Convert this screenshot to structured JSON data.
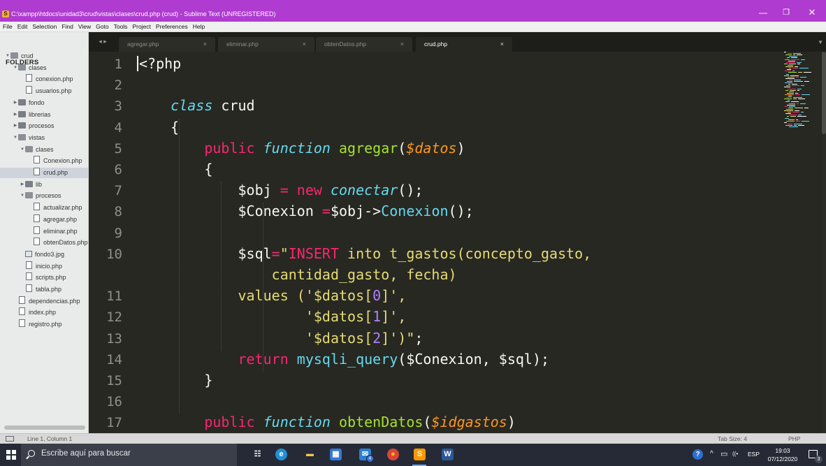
{
  "window": {
    "title": "C:\\xampp\\htdocs\\unidad3\\crud\\vistas\\clases\\crud.php (crud) - Sublime Text (UNREGISTERED)",
    "controls": {
      "minimize": "—",
      "maximize": "❐",
      "close": "✕"
    }
  },
  "menu": [
    "File",
    "Edit",
    "Selection",
    "Find",
    "View",
    "Goto",
    "Tools",
    "Project",
    "Preferences",
    "Help"
  ],
  "sidebar": {
    "header": "FOLDERS",
    "items": [
      {
        "label": "crud",
        "type": "folder-open",
        "level": 0
      },
      {
        "label": "clases",
        "type": "folder-open",
        "level": 1
      },
      {
        "label": "conexion.php",
        "type": "file",
        "level": 2
      },
      {
        "label": "usuarios.php",
        "type": "file",
        "level": 2
      },
      {
        "label": "fondo",
        "type": "folder",
        "level": 1
      },
      {
        "label": "librerias",
        "type": "folder",
        "level": 1
      },
      {
        "label": "procesos",
        "type": "folder",
        "level": 1
      },
      {
        "label": "vistas",
        "type": "folder-open",
        "level": 1
      },
      {
        "label": "clases",
        "type": "folder-open",
        "level": 2
      },
      {
        "label": "Conexion.php",
        "type": "file",
        "level": 3
      },
      {
        "label": "crud.php",
        "type": "file",
        "level": 3,
        "selected": true
      },
      {
        "label": "lib",
        "type": "folder",
        "level": 2
      },
      {
        "label": "procesos",
        "type": "folder-open",
        "level": 2
      },
      {
        "label": "actualizar.php",
        "type": "file",
        "level": 3
      },
      {
        "label": "agregar.php",
        "type": "file",
        "level": 3
      },
      {
        "label": "eliminar.php",
        "type": "file",
        "level": 3
      },
      {
        "label": "obtenDatos.php",
        "type": "file",
        "level": 3
      },
      {
        "label": "fondo3.jpg",
        "type": "image",
        "level": 2
      },
      {
        "label": "inicio.php",
        "type": "file",
        "level": 2
      },
      {
        "label": "scripts.php",
        "type": "file",
        "level": 2
      },
      {
        "label": "tabla.php",
        "type": "file",
        "level": 2
      },
      {
        "label": "dependencias.php",
        "type": "file",
        "level": 1
      },
      {
        "label": "index.php",
        "type": "file",
        "level": 1
      },
      {
        "label": "registro.php",
        "type": "file",
        "level": 1
      }
    ]
  },
  "tabs": {
    "nav": "◂ ▸",
    "close": "×",
    "dropdown": "▼",
    "items": [
      {
        "label": "agregar.php"
      },
      {
        "label": "eliminar.php"
      },
      {
        "label": "obtenDatos.php"
      },
      {
        "label": "crud.php",
        "active": true
      }
    ]
  },
  "editor": {
    "lines": [
      {
        "n": "1",
        "tokens": [
          [
            "cursor",
            ""
          ],
          [
            "t",
            "<?php"
          ]
        ]
      },
      {
        "n": "2",
        "tokens": []
      },
      {
        "n": "3",
        "tokens": [
          [
            "t",
            "    "
          ],
          [
            "s",
            "class"
          ],
          [
            "t",
            " crud"
          ]
        ]
      },
      {
        "n": "4",
        "tokens": [
          [
            "t",
            "    {"
          ]
        ]
      },
      {
        "n": "5",
        "tokens": [
          [
            "t",
            "        "
          ],
          [
            "k",
            "public"
          ],
          [
            "t",
            " "
          ],
          [
            "s",
            "function"
          ],
          [
            "t",
            " "
          ],
          [
            "f",
            "agregar"
          ],
          [
            "t",
            "("
          ],
          [
            "p",
            "$datos"
          ],
          [
            "t",
            ")"
          ]
        ]
      },
      {
        "n": "6",
        "tokens": [
          [
            "t",
            "        {"
          ]
        ]
      },
      {
        "n": "7",
        "tokens": [
          [
            "t",
            "            $obj "
          ],
          [
            "o",
            "="
          ],
          [
            "t",
            " "
          ],
          [
            "k",
            "new"
          ],
          [
            "t",
            " "
          ],
          [
            "s",
            "conectar"
          ],
          [
            "t",
            "();"
          ]
        ]
      },
      {
        "n": "8",
        "tokens": [
          [
            "t",
            "            $Conexion "
          ],
          [
            "o",
            "="
          ],
          [
            "t",
            "$obj->"
          ],
          [
            "c",
            "Conexion"
          ],
          [
            "t",
            "();"
          ]
        ]
      },
      {
        "n": "9",
        "tokens": []
      },
      {
        "n": "10",
        "tokens": [
          [
            "t",
            "            $sql"
          ],
          [
            "o",
            "="
          ],
          [
            "str",
            "\""
          ],
          [
            "k",
            "INSERT"
          ],
          [
            "str",
            " into t_gastos(concepto_gasto,"
          ]
        ]
      },
      {
        "n": "",
        "tokens": [
          [
            "str",
            "                cantidad_gasto, fecha)"
          ]
        ]
      },
      {
        "n": "11",
        "tokens": [
          [
            "str",
            "            values ('$datos["
          ],
          [
            "num",
            "0"
          ],
          [
            "str",
            "]',"
          ]
        ]
      },
      {
        "n": "12",
        "tokens": [
          [
            "str",
            "                    '$datos["
          ],
          [
            "num",
            "1"
          ],
          [
            "str",
            "]',"
          ]
        ]
      },
      {
        "n": "13",
        "tokens": [
          [
            "str",
            "                    '$datos["
          ],
          [
            "num",
            "2"
          ],
          [
            "str",
            "]')\""
          ],
          [
            "t",
            ";"
          ]
        ]
      },
      {
        "n": "14",
        "tokens": [
          [
            "t",
            "            "
          ],
          [
            "k",
            "return"
          ],
          [
            "t",
            " "
          ],
          [
            "c",
            "mysqli_query"
          ],
          [
            "t",
            "($Conexion, $sql);"
          ]
        ]
      },
      {
        "n": "15",
        "tokens": [
          [
            "t",
            "        }"
          ]
        ]
      },
      {
        "n": "16",
        "tokens": []
      },
      {
        "n": "17",
        "tokens": [
          [
            "t",
            "        "
          ],
          [
            "k",
            "public"
          ],
          [
            "t",
            " "
          ],
          [
            "s",
            "function"
          ],
          [
            "t",
            " "
          ],
          [
            "f",
            "obtenDatos"
          ],
          [
            "t",
            "("
          ],
          [
            "p",
            "$idgastos"
          ],
          [
            "t",
            ")"
          ]
        ]
      }
    ]
  },
  "status": {
    "position": "Line 1, Column 1",
    "tab_size": "Tab Size: 4",
    "syntax": "PHP"
  },
  "taskbar": {
    "search_placeholder": "Escribe aquí para buscar",
    "apps": [
      {
        "name": "task-view",
        "glyph": "☷",
        "color": "#ffffff",
        "bg": "transparent"
      },
      {
        "name": "edge",
        "glyph": "e",
        "color": "#ffffff",
        "bg": "#1f8fd6"
      },
      {
        "name": "file-explorer",
        "glyph": "▬",
        "color": "#f2c744",
        "bg": "transparent"
      },
      {
        "name": "store",
        "glyph": "▦",
        "color": "#ffffff",
        "bg": "#3478d4"
      },
      {
        "name": "mail",
        "glyph": "✉",
        "color": "#ffffff",
        "bg": "#2a7fd4",
        "badge": "4"
      },
      {
        "name": "chrome",
        "glyph": "●",
        "color": "#f4c20d",
        "bg": "#db4437"
      },
      {
        "name": "sublime",
        "glyph": "S",
        "color": "#ffffff",
        "bg": "#ff9800"
      },
      {
        "name": "word",
        "glyph": "W",
        "color": "#ffffff",
        "bg": "#2b5797"
      }
    ],
    "tray": {
      "chevron": "^",
      "battery": "▭",
      "wifi": "((•",
      "language": "ESP",
      "time": "19:03",
      "date": "07/12/2020",
      "notifications": "3"
    }
  }
}
